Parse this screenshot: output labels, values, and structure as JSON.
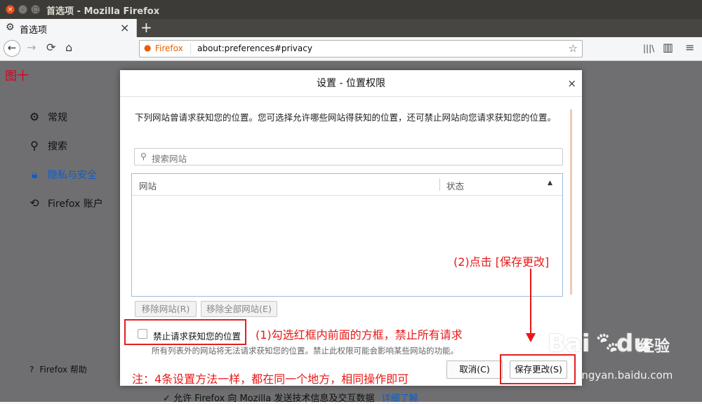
{
  "window": {
    "title": "首选项 - Mozilla Firefox"
  },
  "tab": {
    "icon": "gear-icon",
    "label": "首选项",
    "close": "×",
    "new_tab": "+"
  },
  "navbar": {
    "back": "←",
    "forward": "→",
    "reload": "⟳",
    "home": "⌂",
    "identity_label": "Firefox",
    "url": "about:preferences#privacy",
    "bookmark_star": "☆",
    "library": "|||\\",
    "sidebar": "▥",
    "menu": "≡"
  },
  "annotation": {
    "figure_label": "图十",
    "step1": "(1)勾选红框内前面的方框，禁止所有请求",
    "step2": "(2)点击 [保存更改]",
    "note": "注：4条设置方法一样，都在同一个地方，相同操作即可"
  },
  "sidebar": {
    "items": [
      {
        "icon": "gear-icon",
        "label": "常规",
        "active": false
      },
      {
        "icon": "search-icon",
        "label": "搜索",
        "active": false
      },
      {
        "icon": "lock-icon",
        "label": "隐私与安全",
        "active": true
      },
      {
        "icon": "sync-icon",
        "label": "Firefox 账户",
        "active": false
      }
    ],
    "help": "Firefox 帮助"
  },
  "background": {
    "telemetry_check": "✓",
    "telemetry_text": "允许 Firefox 向 Mozilla 发送技术信息及交互数据",
    "learn_more": "详细了解"
  },
  "dialog": {
    "title": "设置 - 位置权限",
    "close": "×",
    "description": "下列网站曾请求获知您的位置。您可选择允许哪些网站得获知的位置，还可禁止网站向您请求获知您的位置。",
    "search_placeholder": "搜索网站",
    "table": {
      "col_site": "网站",
      "col_status": "状态",
      "sort_indicator": "▲",
      "rows": []
    },
    "remove_site": "移除网站(R)",
    "remove_all": "移除全部网站(E)",
    "block_label": "禁止请求获知您的位置",
    "block_checked": false,
    "block_note": "所有列表外的网站将无法请求获知您的位置。禁止此权限可能会影响某些网站的功能。",
    "cancel": "取消(C)",
    "save": "保存更改(S)"
  },
  "watermark": {
    "logo": "Bai",
    "logo2": "du",
    "brand": "经验",
    "url": "jingyan.baidu.com"
  },
  "colors": {
    "accent_red": "#e81818",
    "link_blue": "#0a5fcf",
    "ubuntu_orange": "#e95420"
  }
}
